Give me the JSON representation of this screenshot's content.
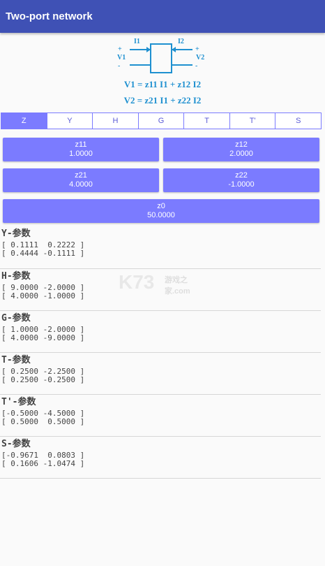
{
  "appbar": {
    "title": "Two-port network"
  },
  "diagram": {
    "i1": "I1",
    "i2": "I2",
    "v1": "V1",
    "v2": "V2",
    "plus": "+",
    "minus": "-"
  },
  "equations": {
    "eq1": "V1 = z11 I1 + z12 I2",
    "eq2": "V2 = z21 I1 + z22 I2"
  },
  "tabs": [
    {
      "label": "Z"
    },
    {
      "label": "Y"
    },
    {
      "label": "H"
    },
    {
      "label": "G"
    },
    {
      "label": "T"
    },
    {
      "label": "T'"
    },
    {
      "label": "S"
    }
  ],
  "params": {
    "z11": {
      "name": "z11",
      "value": "1.0000"
    },
    "z12": {
      "name": "z12",
      "value": "2.0000"
    },
    "z21": {
      "name": "z21",
      "value": "4.0000"
    },
    "z22": {
      "name": "z22",
      "value": "-1.0000"
    },
    "z0": {
      "name": "z0",
      "value": "50.0000"
    }
  },
  "results": [
    {
      "title": "Y-参数",
      "rows": [
        "[ 0.1111  0.2222 ]",
        "[ 0.4444 -0.1111 ]"
      ]
    },
    {
      "title": "H-参数",
      "rows": [
        "[ 9.0000 -2.0000 ]",
        "[ 4.0000 -1.0000 ]"
      ]
    },
    {
      "title": "G-参数",
      "rows": [
        "[ 1.0000 -2.0000 ]",
        "[ 4.0000 -9.0000 ]"
      ]
    },
    {
      "title": "T-参数",
      "rows": [
        "[ 0.2500 -2.2500 ]",
        "[ 0.2500 -0.2500 ]"
      ]
    },
    {
      "title": "T'-参数",
      "rows": [
        "[-0.5000 -4.5000 ]",
        "[ 0.5000  0.5000 ]"
      ]
    },
    {
      "title": "S-参数",
      "rows": [
        "[-0.9671  0.0803 ]",
        "[ 0.1606 -1.0474 ]"
      ]
    }
  ],
  "watermark": {
    "logo": "K73",
    "site": "游戏之家",
    "domain": ".com"
  },
  "colors": {
    "appbar": "#3f51b5",
    "accent": "#7b7bff",
    "diagram": "#1e90d0"
  }
}
